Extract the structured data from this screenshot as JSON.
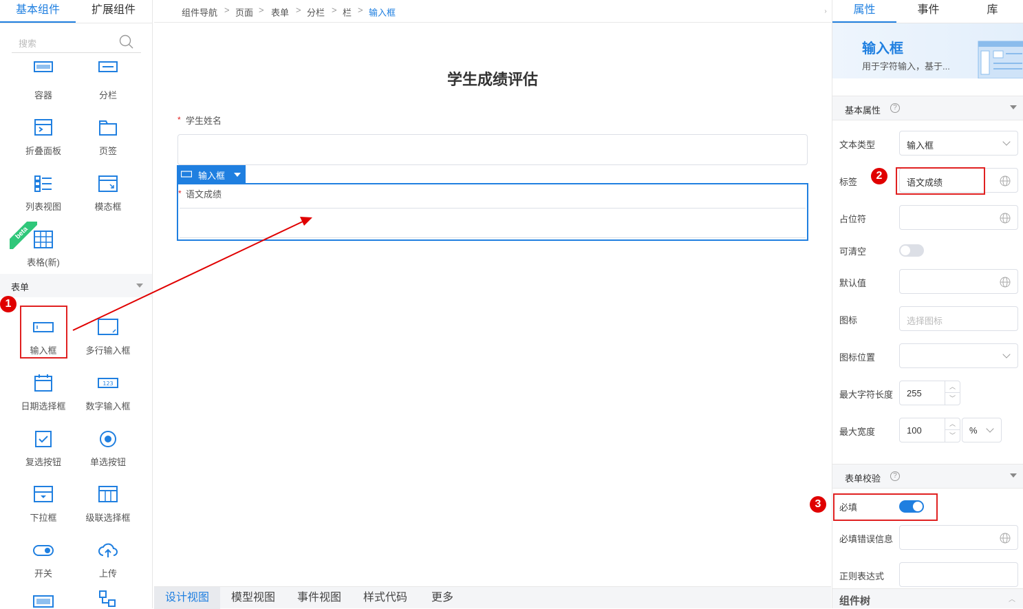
{
  "left": {
    "tabs": [
      "基本组件",
      "扩展组件"
    ],
    "search_placeholder": "搜索",
    "components_top": [
      "容器",
      "分栏",
      "折叠面板",
      "页签",
      "列表视图",
      "模态框",
      "表格(新)"
    ],
    "beta_label": "beta",
    "section_form": "表单",
    "form_components": [
      "输入框",
      "多行输入框",
      "日期选择框",
      "数字输入框",
      "复选按钮",
      "单选按钮",
      "下拉框",
      "级联选择框",
      "开关",
      "上传"
    ]
  },
  "breadcrumb": [
    "组件导航",
    "页面",
    "表单",
    "分栏",
    "栏",
    "输入框"
  ],
  "canvas": {
    "title": "学生成绩评估",
    "field1_label": "学生姓名",
    "field2_label": "语文成绩",
    "selected_tag": "输入框",
    "required_mark": "*"
  },
  "bottom_tabs": [
    "设计视图",
    "模型视图",
    "事件视图",
    "样式代码",
    "更多"
  ],
  "right": {
    "tabs": [
      "属性",
      "事件",
      "库"
    ],
    "banner_title": "输入框",
    "banner_desc": "用于字符输入，基于...",
    "section_basic": "基本属性",
    "props": {
      "text_type_label": "文本类型",
      "text_type_value": "输入框",
      "label_label": "标签",
      "label_value": "语文成绩",
      "placeholder_label": "占位符",
      "clearable_label": "可清空",
      "default_label": "默认值",
      "icon_label": "图标",
      "icon_placeholder": "选择图标",
      "icon_pos_label": "图标位置",
      "maxlen_label": "最大字符长度",
      "maxlen_value": "255",
      "maxwidth_label": "最大宽度",
      "maxwidth_value": "100",
      "maxwidth_unit": "%"
    },
    "section_validate": "表单校验",
    "validate": {
      "required_label": "必填",
      "required_msg_label": "必填错误信息",
      "regex_label": "正则表达式"
    },
    "section_tree": "组件树"
  },
  "annotations": [
    "1",
    "2",
    "3"
  ],
  "colors": {
    "accent": "#1f7fe0",
    "annotation_red": "#e00000"
  }
}
